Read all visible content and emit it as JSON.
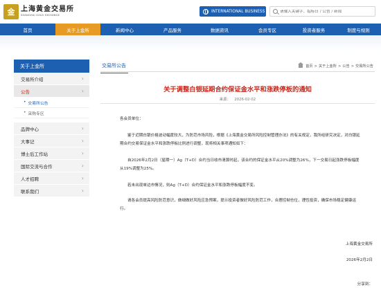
{
  "header": {
    "logo_mark": "金",
    "logo_cn": "上海黄金交易所",
    "logo_en": "SHANGHAI GOLD EXCHANGE",
    "intl_label": "INTERNATIONAL BUSINESS",
    "search_placeholder": "请输入关键字、指标日 / 公告 / 新闻"
  },
  "nav": [
    "首页",
    "关于上金所",
    "新闻中心",
    "产品服务",
    "数据资讯",
    "会员专区",
    "投资者服务",
    "制度与规则"
  ],
  "sidebar": {
    "title": "关于上金所",
    "items": {
      "intro": "交易所介绍",
      "notice": "公告",
      "notice_sub1": "交易所公告",
      "notice_sub2": "采购专区",
      "brand": "品牌中心",
      "events": "大事记",
      "postdoc": "博士后工作站",
      "intl": "国际交流与合作",
      "hr": "人才招聘",
      "contact": "联系我们"
    }
  },
  "main": {
    "section_title": "交易所公告",
    "breadcrumb": {
      "home": "首页",
      "sep": ">",
      "level1": "关于上金所",
      "level2": "公告",
      "level3": "交易所公告"
    },
    "article": {
      "title": "关于调整白银延期合约保证金水平和涨跌停板的通知",
      "source_label": "来源：",
      "date": "2026-02-02",
      "greeting": "各会员单位：",
      "para1": "鉴于近期白银价格波动幅度较大，为防范市场风险，根据《上海黄金交易所风险控制管理办法》的有关规定，我所经研究决定，对白银延期合约交易保证金水平和涨跌停板比例进行调整，现将相关事项通知如下：",
      "para2": "自2026年2月2日（星期一）Ag（T+D）合约当日收市清算时起，该合约的保证金水平从20%调整为26%，下一交易日起涨跌停板幅度从19%调整为25%。",
      "para3": "若未出现单边市情况，则Ag（T+D）合约保证金水平和涨跌停板幅度不变。",
      "para4": "请各会员提高风险防范意识，做细做好风险应急预案，提示投资者做好风险防范工作，合理控制仓位，理性投资，确保市场稳定健康运行。",
      "sign_org": "上海黄金交易所",
      "sign_date": "2026年2月2日",
      "share": "分享到："
    }
  },
  "colors": {
    "primary": "#1d5fb0",
    "accent": "#e79a24",
    "title_red": "#c8291e"
  }
}
